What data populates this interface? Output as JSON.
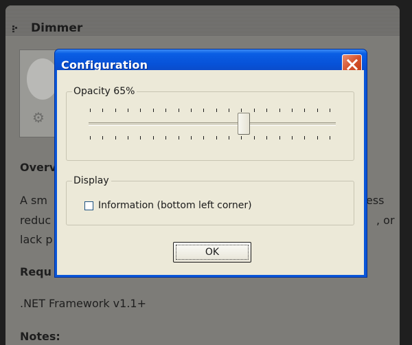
{
  "background_page": {
    "title": "Dimmer",
    "overview_heading": "Overv",
    "text_line1": "A  sm",
    "text_line2": "reduc",
    "text_line3": "lack p",
    "text_right1": "ess",
    "text_right2": ", or",
    "requirements_heading": "Requ",
    "requirement_1": ".NET Framework v1.1+",
    "notes_heading": "Notes:"
  },
  "dialog": {
    "title": "Configuration",
    "opacity": {
      "legend": "Opacity  65%",
      "value_percent": 65,
      "tick_count": 20
    },
    "display": {
      "legend": "Display",
      "checkbox_label": "Information (bottom left corner)",
      "checked": false
    },
    "ok_label": "OK"
  },
  "colors": {
    "titlebar": "#0a5ee4",
    "dialog_face": "#ece9d8",
    "close_button": "#d5522d"
  }
}
